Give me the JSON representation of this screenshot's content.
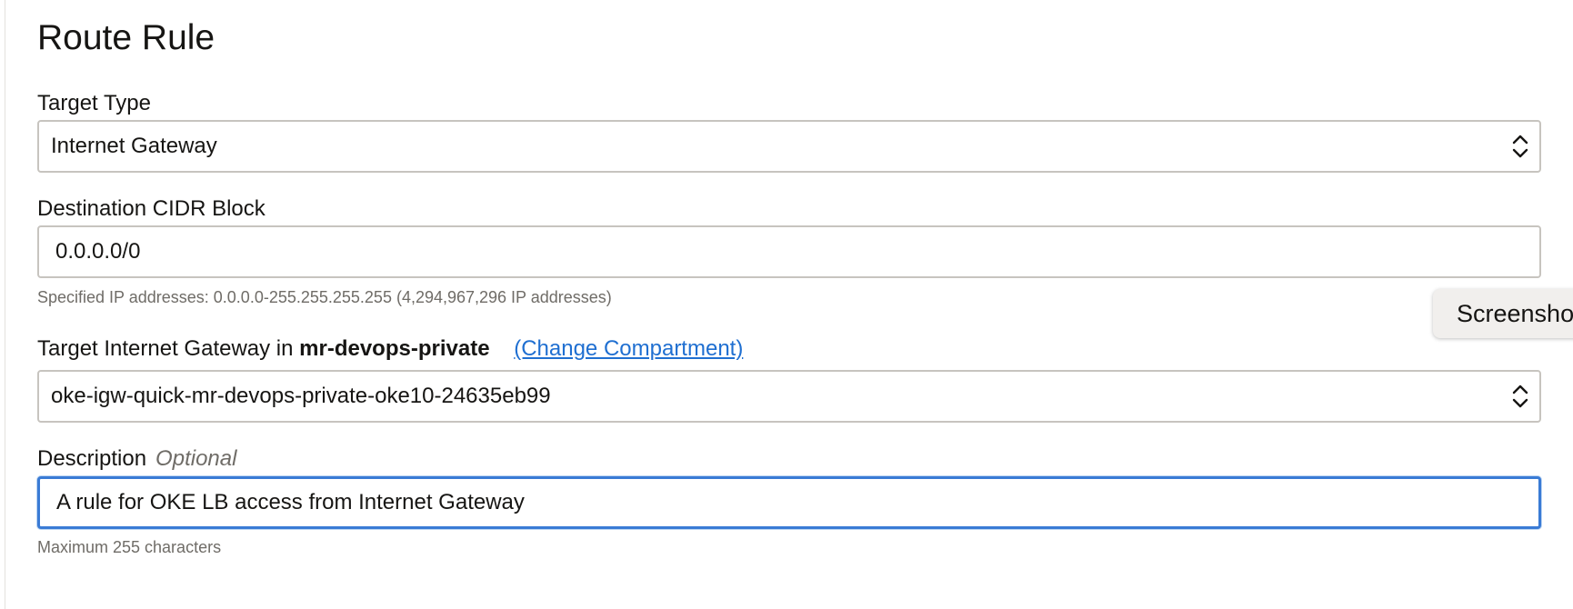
{
  "title": "Route Rule",
  "target_type": {
    "label": "Target Type",
    "value": "Internet Gateway",
    "icon": "chevron-updown-icon"
  },
  "destination_cidr": {
    "label": "Destination CIDR Block",
    "value": "0.0.0.0/0",
    "hint": "Specified IP addresses: 0.0.0.0-255.255.255.255 (4,294,967,296 IP addresses)"
  },
  "target_gateway": {
    "label_prefix": "Target Internet Gateway in",
    "compartment": "mr-devops-private",
    "change_link": "(Change Compartment)",
    "value": "oke-igw-quick-mr-devops-private-oke10-24635eb99",
    "icon": "chevron-updown-icon"
  },
  "description": {
    "label": "Description",
    "optional": "Optional",
    "value": "A rule for OKE LB access from Internet Gateway",
    "hint": "Maximum 255 characters"
  },
  "screenshot_tab": {
    "label": "Screenshot"
  },
  "colors": {
    "link": "#1f6fd1",
    "focus_border": "#3a7bd5",
    "field_border": "#c7c4bf",
    "hint_text": "#6f6c67"
  }
}
